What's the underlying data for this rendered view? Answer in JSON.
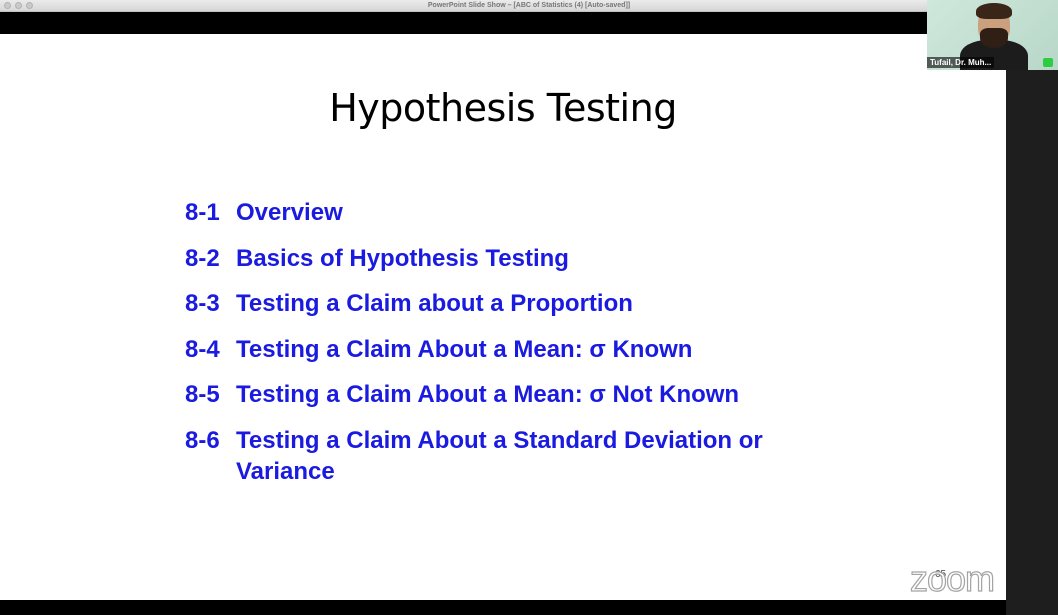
{
  "window": {
    "title": "PowerPoint Slide Show – [ABC of Statistics (4) [Auto-saved]]"
  },
  "slide": {
    "title": "Hypothesis Testing",
    "items": [
      {
        "number": "8-1",
        "text": "Overview"
      },
      {
        "number": "8-2",
        "text": "Basics of Hypothesis Testing"
      },
      {
        "number": "8-3",
        "text": "Testing a Claim about a Proportion"
      },
      {
        "number": "8-4",
        "text": "Testing a Claim About a Mean:  σ Known"
      },
      {
        "number": "8-5",
        "text": "Testing a Claim About a Mean:  σ Not Known"
      },
      {
        "number": "8-6",
        "text": "Testing a Claim About a Standard Deviation or Variance"
      }
    ],
    "page_number": "65",
    "text_color": "#1a1ae0"
  },
  "video": {
    "participant_name": "Tufail, Dr. Muh..."
  },
  "watermark": {
    "logo": "zoom"
  }
}
